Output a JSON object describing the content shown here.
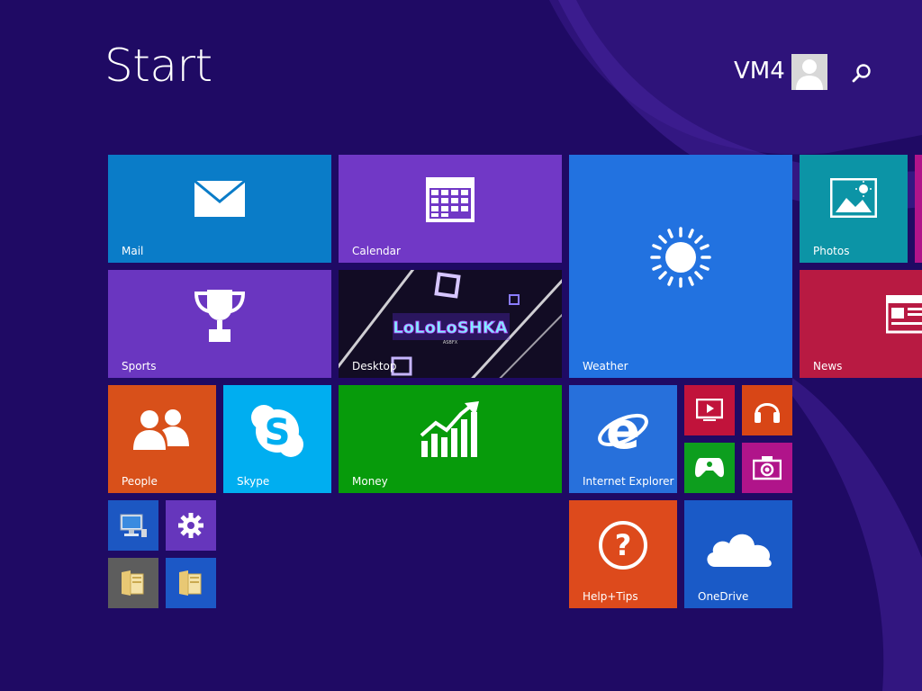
{
  "header": {
    "title": "Start",
    "user_name": "VM4"
  },
  "colors": {
    "background": "#1f0a64",
    "mail": "#0a7cc8",
    "calendar": "#7138c6",
    "weather": "#2272e0",
    "photos": "#0c94a6",
    "sports": "#6a36c0",
    "news": "#b81a42",
    "people": "#d8501a",
    "skype": "#00aef0",
    "money": "#079b0b",
    "internet_explorer": "#2770db",
    "video": "#c1133b",
    "music": "#d84616",
    "games": "#0d9e1e",
    "camera": "#b0148a",
    "help_tips": "#dd4a1c",
    "onedrive": "#1a5ac7",
    "computer": "#1c57c2",
    "settings": "#6636bc",
    "explorer_gray": "#5d5d5d",
    "explorer_blue": "#1c58c6"
  },
  "tiles": {
    "mail": {
      "label": "Mail",
      "icon": "mail-icon"
    },
    "calendar": {
      "label": "Calendar",
      "icon": "calendar-icon"
    },
    "weather": {
      "label": "Weather",
      "icon": "sun-icon"
    },
    "photos": {
      "label": "Photos",
      "icon": "photos-icon"
    },
    "sports": {
      "label": "Sports",
      "icon": "trophy-icon"
    },
    "desktop": {
      "label": "Desktop",
      "wallpaper_text": "LoLoLoSHKA",
      "wallpaper_subtext": "ASBFX"
    },
    "news": {
      "label": "News",
      "icon": "newspaper-icon"
    },
    "people": {
      "label": "People",
      "icon": "people-icon"
    },
    "skype": {
      "label": "Skype",
      "icon": "skype-icon"
    },
    "money": {
      "label": "Money",
      "icon": "chart-icon"
    },
    "internet_explorer": {
      "label": "Internet Explorer",
      "icon": "ie-icon"
    },
    "video": {
      "icon": "video-icon"
    },
    "music": {
      "icon": "headphones-icon"
    },
    "games": {
      "icon": "controller-icon"
    },
    "camera": {
      "icon": "camera-icon"
    },
    "help_tips": {
      "label": "Help+Tips",
      "icon": "question-icon"
    },
    "onedrive": {
      "label": "OneDrive",
      "icon": "cloud-icon"
    },
    "computer": {
      "icon": "computer-icon"
    },
    "settings": {
      "icon": "gear-icon"
    },
    "file_explorer_1": {
      "icon": "folder-icon"
    },
    "file_explorer_2": {
      "icon": "folder-icon"
    }
  }
}
